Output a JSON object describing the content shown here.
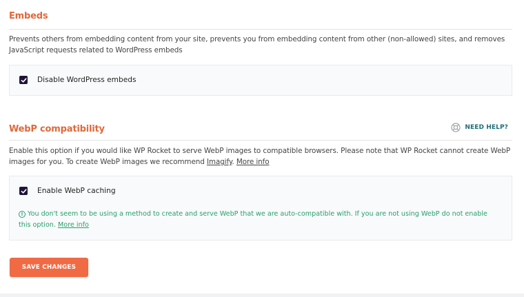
{
  "embeds": {
    "title": "Embeds",
    "description": "Prevents others from embedding content from your site, prevents you from embedding content from other (non-allowed) sites, and removes JavaScript requests related to WordPress embeds",
    "option_label": "Disable WordPress embeds",
    "checked": true
  },
  "webp": {
    "title": "WebP compatibility",
    "help_label": "NEED HELP?",
    "description_part1": "Enable this option if you would like WP Rocket to serve WebP images to compatible browsers. Please note that WP Rocket cannot create WebP images for you. To create WebP images we recommend ",
    "imagify_link": "Imagify",
    "description_part2": ". ",
    "more_info_link": "More info",
    "option_label": "Enable WebP caching",
    "checked": true,
    "warning_text": "You don't seem to be using a method to create and serve WebP that we are auto-compatible with. If you are not using WebP do not enable this option. ",
    "warning_more_info": "More info",
    "warning_icon": "!"
  },
  "save_label": "SAVE CHANGES",
  "colors": {
    "accent": "#e0693b",
    "button": "#f06a44",
    "checkbox": "#1f1538",
    "warning": "#26a06a",
    "help": "#1c6f77"
  }
}
